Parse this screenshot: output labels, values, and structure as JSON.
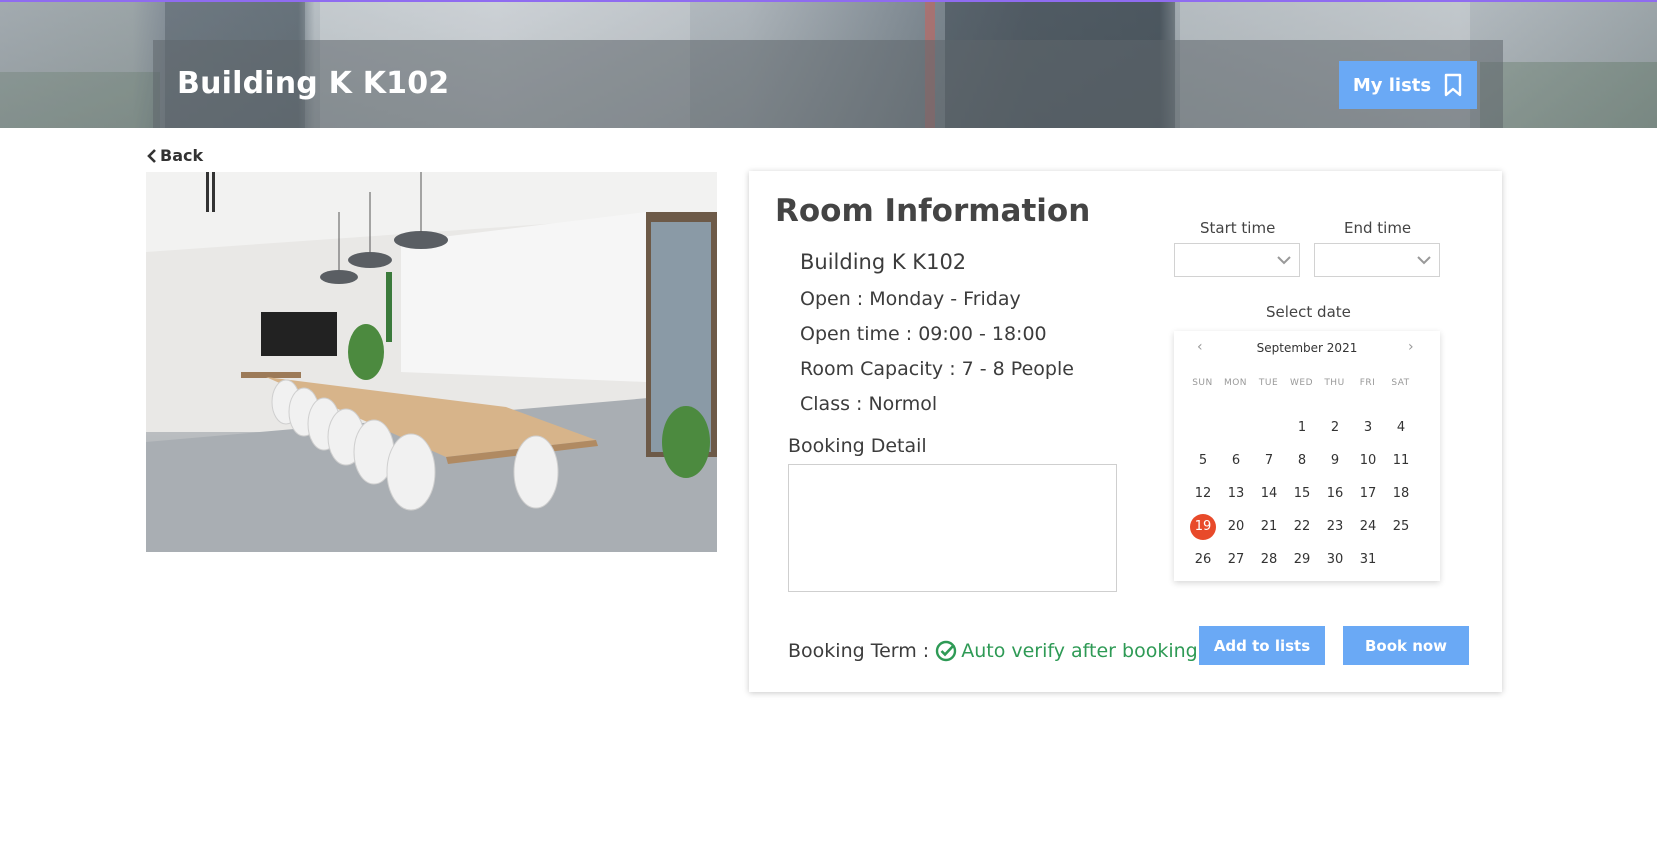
{
  "header": {
    "title": "Building K K102",
    "my_lists_label": "My lists",
    "accent": "#8f6cf0"
  },
  "nav": {
    "back_label": "Back"
  },
  "room_info": {
    "heading": "Room Information",
    "name": "Building K K102",
    "open_days": "Open : Monday - Friday",
    "open_time": "Open time : 09:00 - 18:00",
    "capacity": "Room Capacity : 7 - 8 People",
    "class": "Class : Normol",
    "booking_detail_label": "Booking Detail",
    "booking_detail_value": "",
    "booking_term_label": "Booking Term :",
    "booking_term_value": "Auto verify after booking"
  },
  "time": {
    "start_label": "Start time",
    "end_label": "End time",
    "start_value": "",
    "end_value": ""
  },
  "calendar": {
    "label": "Select date",
    "month": "September 2021",
    "weekdays": [
      "SUN",
      "MON",
      "TUE",
      "WED",
      "THU",
      "FRI",
      "SAT"
    ],
    "first_weekday_index": 3,
    "days_in_month": 31,
    "selected_day": 19,
    "selected_color": "#e84a2a"
  },
  "actions": {
    "add_to_lists": "Add to lists",
    "book_now": "Book now",
    "button_color": "#6aa9f5"
  }
}
